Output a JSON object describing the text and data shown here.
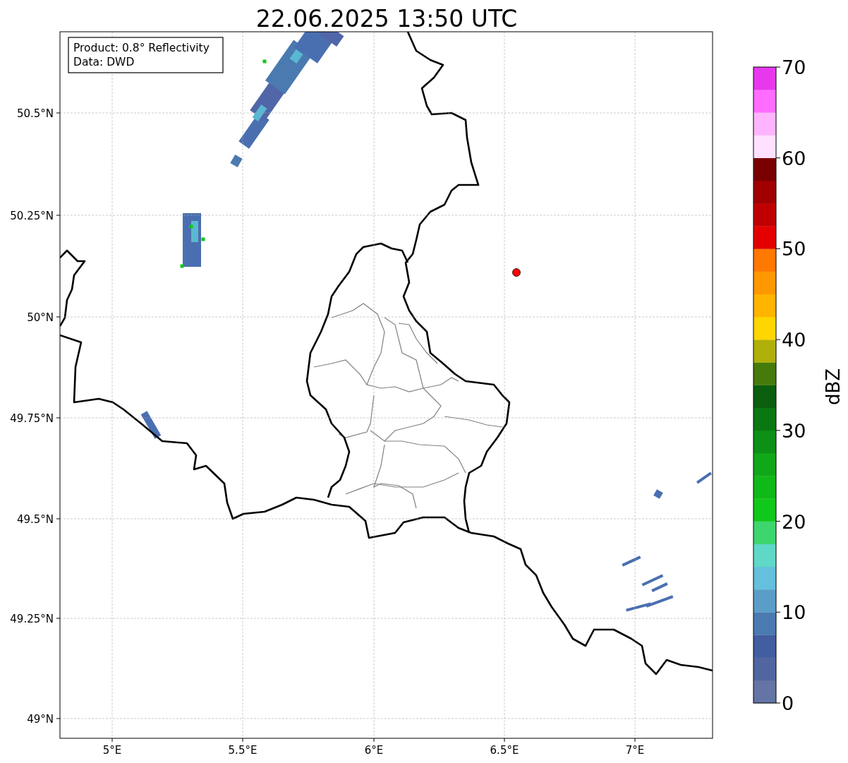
{
  "title": "22.06.2025 13:50 UTC",
  "info_box": {
    "lines": [
      "Product: 0.8° Reflectivity",
      "Data: DWD"
    ]
  },
  "lat_ticks": [
    "50.5°N",
    "50.25°N",
    "50°N",
    "49.75°N",
    "49.5°N",
    "49.25°N",
    "49°N"
  ],
  "lon_ticks": [
    "5°E",
    "5.5°E",
    "6°E",
    "6.5°E",
    "7°E"
  ],
  "colorbar": {
    "label": "dBZ",
    "ticks": [
      "70",
      "60",
      "50",
      "40",
      "30",
      "20",
      "10",
      "0"
    ],
    "segments": [
      {
        "color": "#6474a5"
      },
      {
        "color": "#5166a0"
      },
      {
        "color": "#425ea0"
      },
      {
        "color": "#4a7ab0"
      },
      {
        "color": "#5a9ec8"
      },
      {
        "color": "#64c0dc"
      },
      {
        "color": "#5fd8c8"
      },
      {
        "color": "#3dd66e"
      },
      {
        "color": "#10c81a"
      },
      {
        "color": "#10b818"
      },
      {
        "color": "#10a818"
      },
      {
        "color": "#0c9016"
      },
      {
        "color": "#0a7812"
      },
      {
        "color": "#0a5e0e"
      },
      {
        "color": "#467a0a"
      },
      {
        "color": "#b0b00a"
      },
      {
        "color": "#ffd600"
      },
      {
        "color": "#ffb400"
      },
      {
        "color": "#ff9800"
      },
      {
        "color": "#ff7800"
      },
      {
        "color": "#e40000"
      },
      {
        "color": "#c00000"
      },
      {
        "color": "#a00000"
      },
      {
        "color": "#780000"
      },
      {
        "color": "#ffe0ff"
      },
      {
        "color": "#ffb4ff"
      },
      {
        "color": "#ff6cff"
      },
      {
        "color": "#e838ee"
      }
    ]
  }
}
